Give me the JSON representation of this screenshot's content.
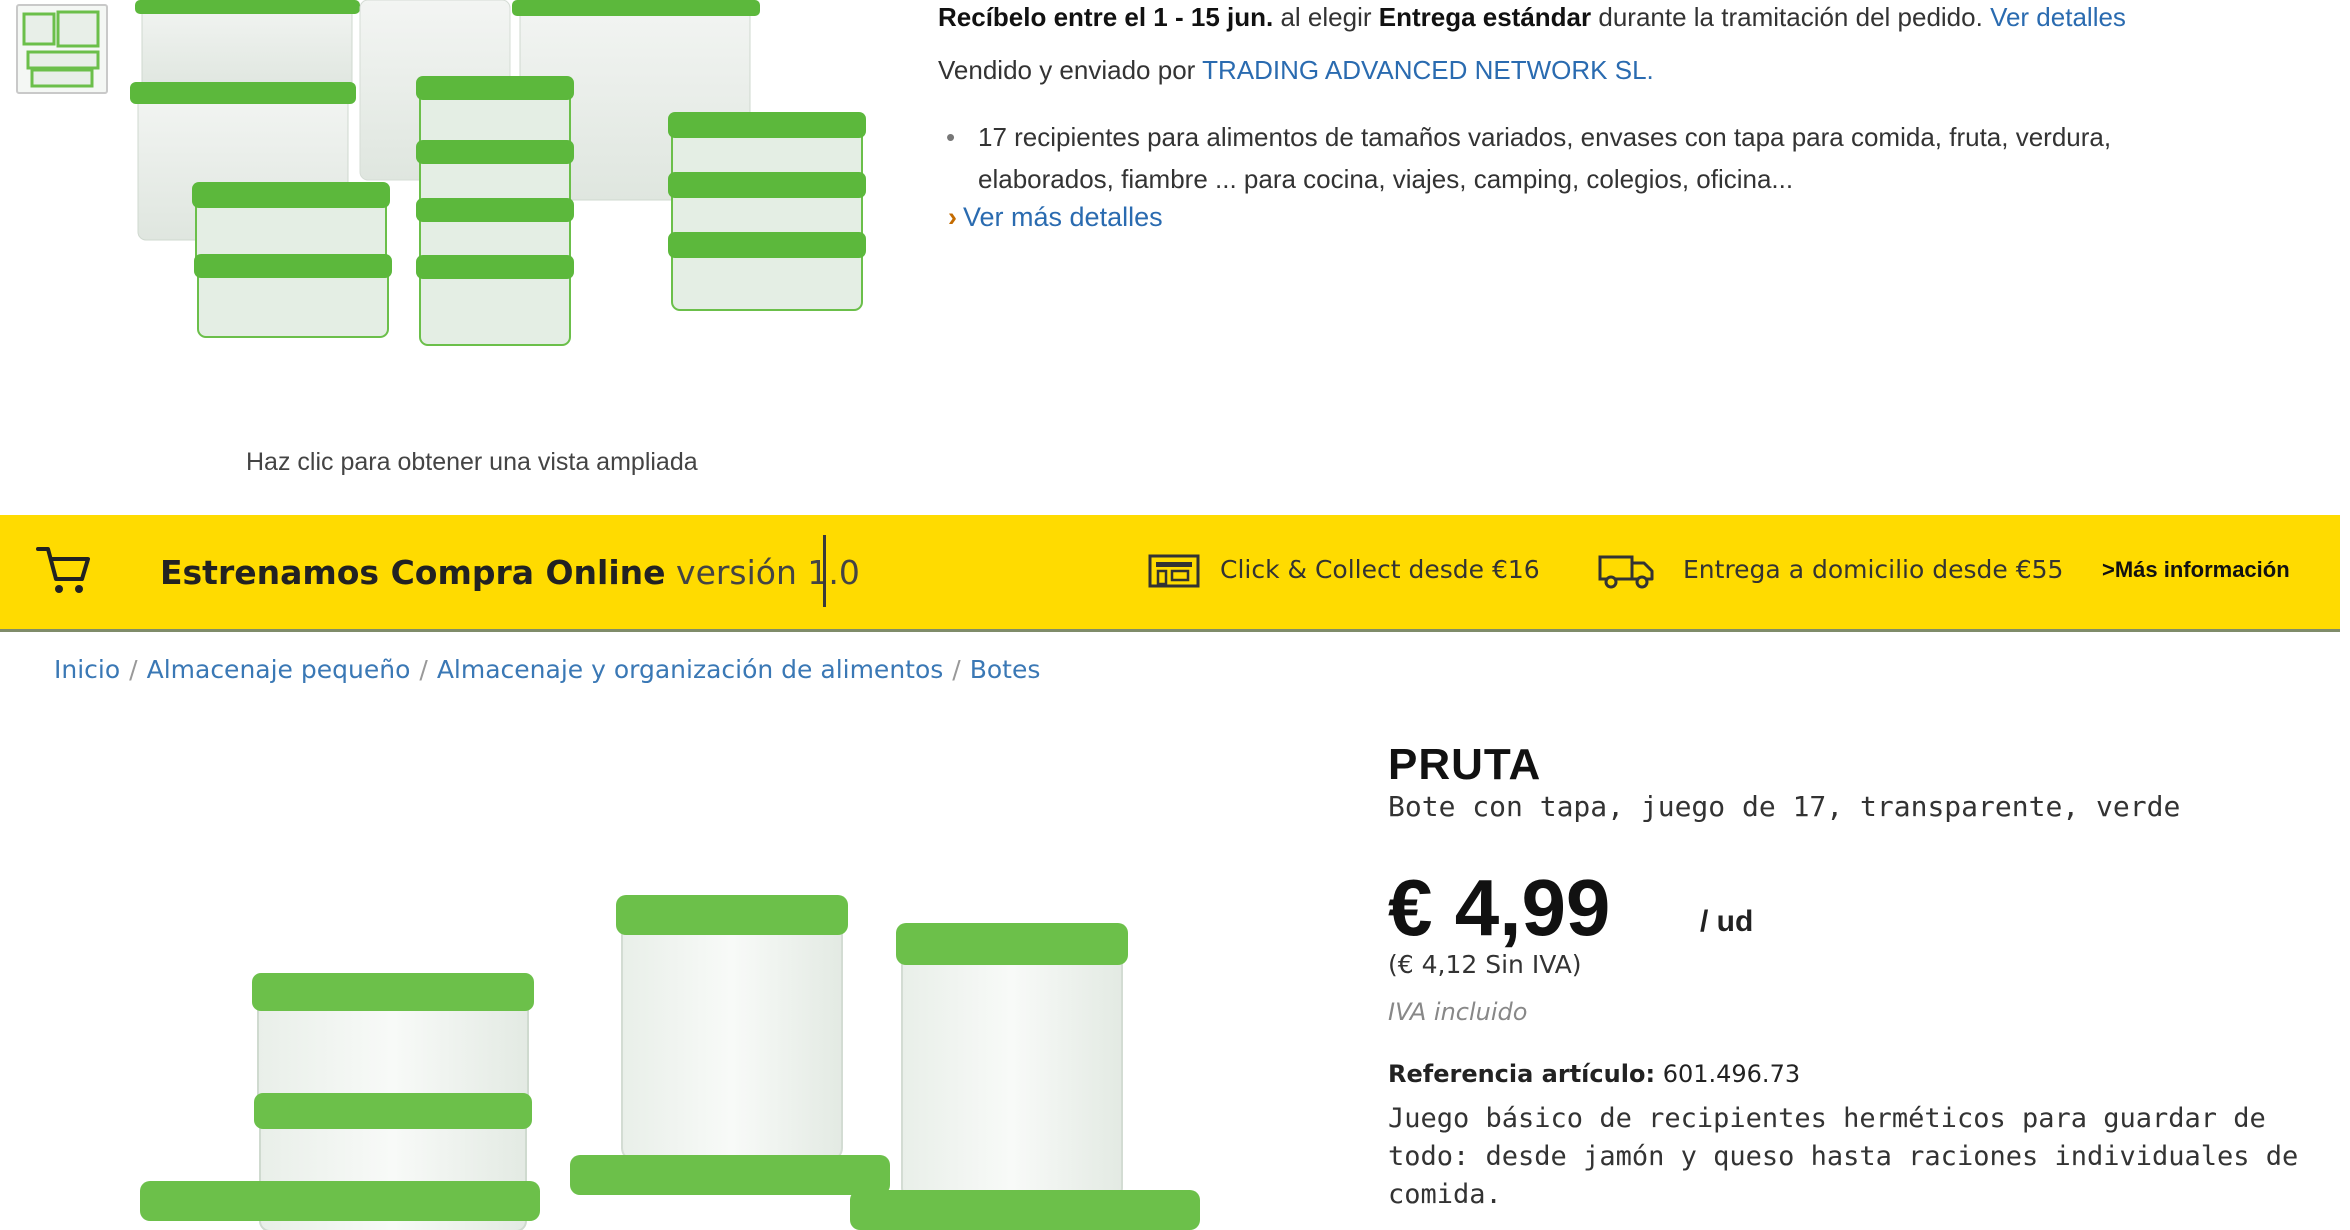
{
  "top": {
    "zoom_hint": "Haz clic para obtener una vista ampliada",
    "delivery": {
      "part1": "Recíbelo entre el 1 - 15 jun.",
      "part2": " al elegir ",
      "part3": "Entrega estándar",
      "part4": " durante la tramitación del pedido. ",
      "link": "Ver detalles"
    },
    "seller": {
      "prefix": "Vendido y enviado por ",
      "name": "TRADING ADVANCED NETWORK SL."
    },
    "bullet": "17 recipientes para alimentos de tamaños variados, envases con tapa para comida, fruta, verdura, elaborados, fiambre ... para cocina, viajes, camping, colegios, oficina...",
    "more_details": "Ver más detalles"
  },
  "banner": {
    "title": "Estrenamos Compra Online",
    "version": " versión 1.0",
    "click_collect": "Click & Collect desde €16",
    "home_delivery": "Entrega a domicilio desde €55",
    "more_info": ">Más información",
    "color": "#ffdb00"
  },
  "breadcrumb": [
    "Inicio",
    "Almacenaje pequeño",
    "Almacenaje y organización de alimentos",
    "Botes"
  ],
  "product": {
    "name": "PRUTA",
    "description": "Bote con tapa, juego de 17, transparente, verde",
    "price": "€ 4,99",
    "unit": "/ ud",
    "price_no_vat": "(€ 4,12 Sin IVA)",
    "vat_included": "IVA incluido",
    "ref_label": "Referencia artículo:",
    "ref_value": "601.496.73",
    "long_description": "Juego básico de recipientes herméticos para guardar de todo: desde jamón y queso hasta raciones individuales de comida."
  },
  "icons": {
    "cart": "shopping-cart-icon",
    "store": "store-icon",
    "truck": "delivery-truck-icon"
  },
  "colors": {
    "lid_green": "#5cb83c",
    "link_blue": "#2a6bb0"
  }
}
